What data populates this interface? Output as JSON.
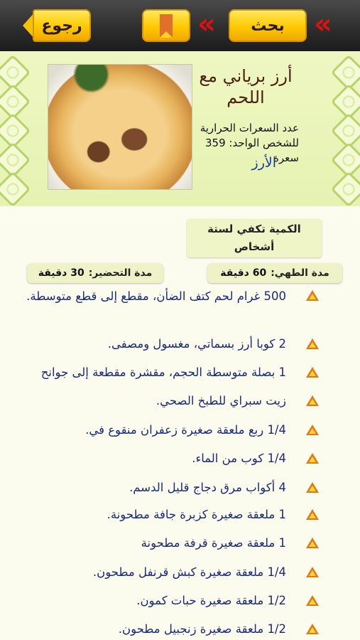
{
  "toolbar": {
    "back_label": "رجوع",
    "search_label": "بحث",
    "prev_glyph": "«",
    "next_glyph": "«",
    "accent_color": "#ffc800",
    "arrow_color": "#e01010"
  },
  "recipe": {
    "title": "أرز برياني مع اللحم",
    "calories_text": "عدد السعرات الحرارية للشخص الواحد: 359 سعرة",
    "category": "الأرز",
    "photo_icon": "dish-photo"
  },
  "details": {
    "servings": "الكمية تكفي لستة أشخاص",
    "cook_label": "مدة الطهي:",
    "cook_value": "60 دقيقة",
    "prep_label": "مدة التحضير:",
    "prep_value": "30 دقيقة"
  },
  "ingredients": [
    "500 غرام لحم كتف الضأن، مقطع إلى قطع متوسطة.",
    "2 كوبا أرز بسماتي، مغسول ومصفى.",
    "1 بصلة متوسطة الحجم، مقشرة مقطعة إلى جوانح",
    "زيت سبراي للطبخ الصحي.",
    "1/4 ربع ملعقة صغيرة زعفران منقوع في.",
    "1/4 كوب من الماء.",
    "4 أكواب مرق دجاج قليل الدسم.",
    "1 ملعقة صغيرة كزبرة جافة مطحونة.",
    "1 ملعقة صغيرة قرفة مطحونة",
    "1/4 ملعقة صغيرة كبش قرنفل مطحون.",
    "1/2 ملعقة صغيرة حبات كمون.",
    "1/2 ملعقة صغيرة زنجبيل مطحون."
  ]
}
